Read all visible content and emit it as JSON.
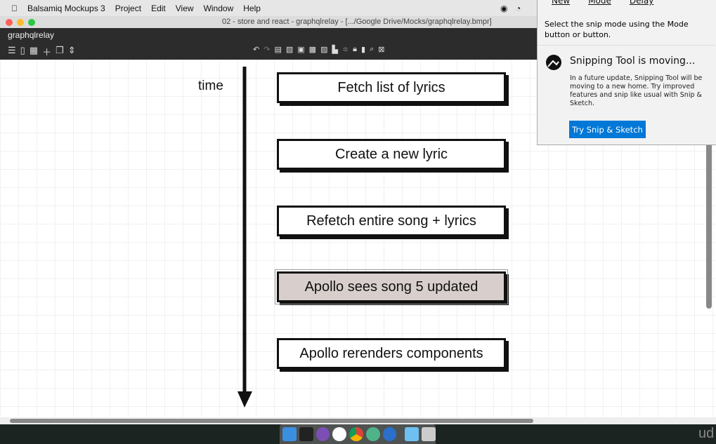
{
  "menubar": {
    "app": "Balsamiq Mockups 3",
    "items": [
      "Project",
      "Edit",
      "View",
      "Window",
      "Help"
    ]
  },
  "window": {
    "title": "02 - store and react - graphqlrelay - [.../Google Drive/Mocks/graphqlrelay.bmpr]",
    "project": "graphqlrelay"
  },
  "canvas": {
    "time_label": "time",
    "steps": [
      "Fetch list of lyrics",
      "Create a new lyric",
      "Refetch entire song + lyrics",
      "Apollo sees song 5 updated",
      "Apollo rerenders components"
    ],
    "selected_index": 3
  },
  "snip": {
    "toolbar": [
      "New",
      "Mode",
      "Delay"
    ],
    "hint": "Select the snip mode using the Mode button or button.",
    "heading": "Snipping Tool is moving...",
    "body": "In a future update, Snipping Tool will be moving to a new home. Try improved features and snip like usual with Snip & Sketch.",
    "button": "Try Snip & Sketch",
    "accent": "#0078d7"
  },
  "watermark": "ud"
}
